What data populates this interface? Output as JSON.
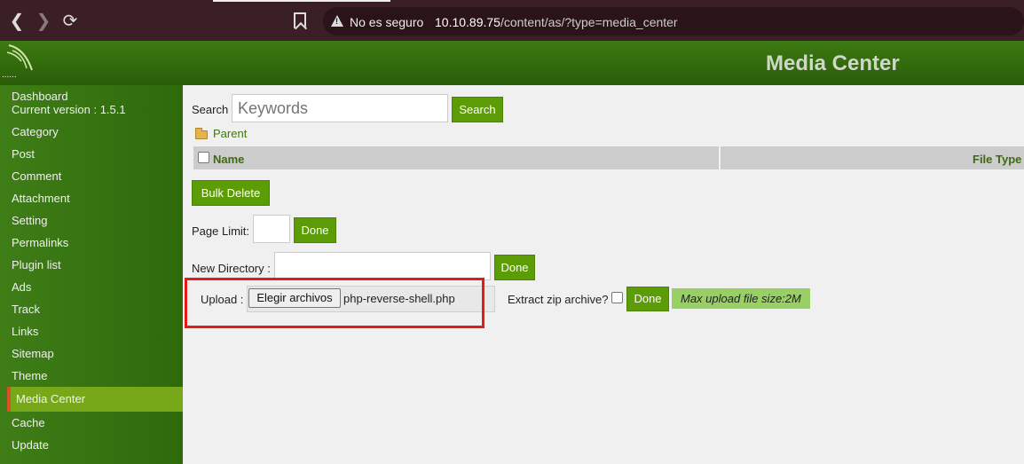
{
  "browser": {
    "security_label": "No es seguro",
    "url_host": "10.10.89.75",
    "url_path": "/content/as/?type=media_center"
  },
  "header": {
    "title": "Media Center",
    "logo_dots": "......"
  },
  "sidebar": {
    "dashboard": "Dashboard",
    "version": "Current version : 1.5.1",
    "items": [
      "Category",
      "Post",
      "Comment",
      "Attachment",
      "Setting",
      "Permalinks",
      "Plugin list",
      "Ads",
      "Track",
      "Links",
      "Sitemap",
      "Theme",
      "Media Center",
      "Cache",
      "Update"
    ],
    "active": "Media Center"
  },
  "main": {
    "search_label": "Search",
    "search_placeholder": "Keywords",
    "search_button": "Search",
    "parent_link": "Parent",
    "columns": [
      "Name",
      "File Type"
    ],
    "bulk_delete": "Bulk Delete",
    "page_limit_label": "Page Limit:",
    "page_limit_done": "Done",
    "new_directory_label": "New Directory :",
    "new_directory_done": "Done",
    "upload_label": "Upload :",
    "choose_files": "Elegir archivos",
    "selected_file": "php-reverse-shell.php",
    "extract_label": "Extract zip archive?",
    "upload_done": "Done",
    "max_upload": "Max upload file size:2M"
  },
  "colors": {
    "accent_green": "#5c9c06",
    "highlight_red": "#e51b1b",
    "active_item": "#77a81a"
  }
}
